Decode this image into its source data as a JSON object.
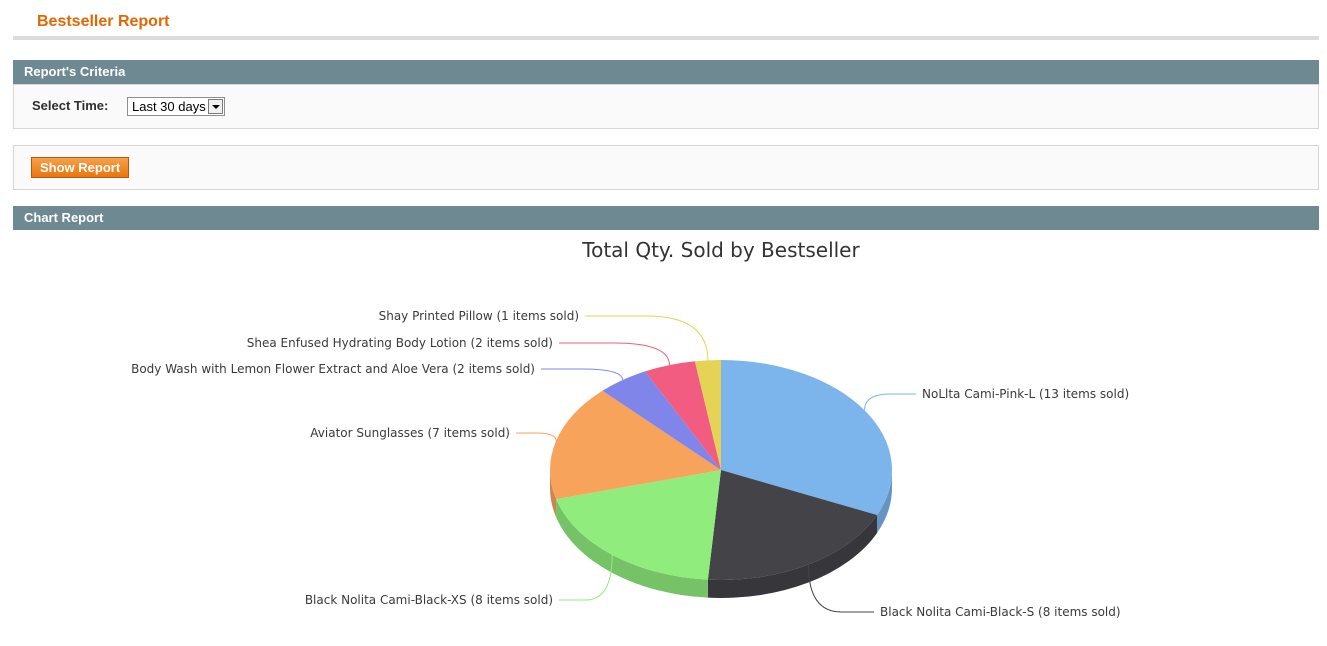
{
  "page": {
    "title": "Bestseller Report"
  },
  "criteria": {
    "header": "Report's Criteria",
    "select_time_label": "Select Time:",
    "select_time_value": "Last 30 days"
  },
  "actions": {
    "show_report_label": "Show Report"
  },
  "chart_section": {
    "header": "Chart Report"
  },
  "colors": {
    "accent": "#e26703",
    "section_header": "#6f8992",
    "button": "#f0821e"
  },
  "icons": {
    "select_arrow": "chevron-down-icon"
  },
  "chart_data": {
    "type": "pie",
    "title": "Total Qty. Sold by Bestseller",
    "labels": [
      "NoLlta Cami-Pink-L (13 items sold)",
      "Black Nolita Cami-Black-S (8 items sold)",
      "Black Nolita Cami-Black-XS (8 items sold)",
      "Aviator Sunglasses (7 items sold)",
      "Body Wash with Lemon Flower Extract and Aloe Vera (2 items sold)",
      "Shea Enfused Hydrating Body Lotion (2 items sold)",
      "Shay Printed Pillow (1 items sold)"
    ],
    "values": [
      13,
      8,
      8,
      7,
      2,
      2,
      1
    ],
    "colors": [
      "#7cb5ec",
      "#434348",
      "#90ed7d",
      "#f7a35c",
      "#8085e9",
      "#f15c80",
      "#e4d354"
    ],
    "legend": "none",
    "style": "3d"
  }
}
